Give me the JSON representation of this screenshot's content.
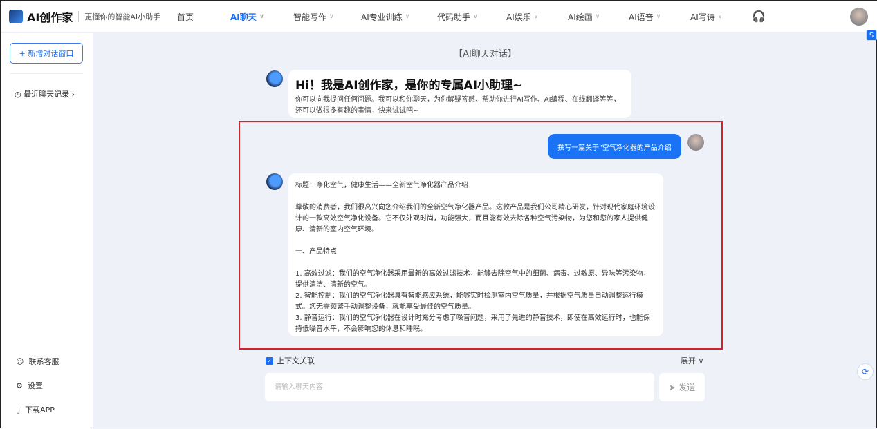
{
  "header": {
    "logo": "AI创作家",
    "slogan": "更懂你的智能AI小助手",
    "nav": [
      {
        "label": "首页",
        "chev": false
      },
      {
        "label": "AI聊天",
        "chev": true,
        "active": true
      },
      {
        "label": "智能写作",
        "chev": true
      },
      {
        "label": "AI专业训练",
        "chev": true
      },
      {
        "label": "代码助手",
        "chev": true
      },
      {
        "label": "AI娱乐",
        "chev": true
      },
      {
        "label": "AI绘画",
        "chev": true
      },
      {
        "label": "AI语音",
        "chev": true
      },
      {
        "label": "AI写诗",
        "chev": true
      }
    ]
  },
  "sidebar": {
    "new_chat": "+ 新增对话窗口",
    "history": "最近聊天记录 ›",
    "contact": "联系客服",
    "settings": "设置",
    "download": "下载APP"
  },
  "chat": {
    "title": "【AI聊天对话】",
    "welcome_title": "Hi！我是AI创作家，是你的专属AI小助理~",
    "welcome_desc": "你可以向我提问任何问题。我可以和你聊天，为你解疑答惑、帮助你进行AI写作、AI编程、在线翻译等等，还可以做很多有趣的事情，快来试试吧~",
    "user_message": "撰写一篇关于\"空气净化器的产品介绍",
    "response": [
      "标题：净化空气，健康生活——全新空气净化器产品介绍",
      "",
      "尊敬的消费者，我们很高兴向您介绍我们的全新空气净化器产品。这款产品是我们公司精心研发，针对现代家庭环境设计的一款高效空气净化设备。它不仅外观时尚，功能强大，而且能有效去除各种空气污染物，为您和您的家人提供健康、清新的室内空气环境。",
      "",
      "一、产品特点",
      "",
      "1. 高效过滤：我们的空气净化器采用最新的高效过滤技术，能够去除空气中的细菌、病毒、过敏原、异味等污染物，提供清洁、清新的空气。",
      "2. 智能控制：我们的空气净化器具有智能感应系统，能够实时检测室内空气质量，并根据空气质量自动调整运行模式。您无需频繁手动调整设备，就能享受最佳的空气质量。",
      "3. 静音运行：我们的空气净化器在设计时充分考虑了噪音问题，采用了先进的静音技术，即使在高效运行时，也能保持低噪音水平，不会影响您的休息和睡眠。"
    ]
  },
  "footer": {
    "context_label": "上下文关联",
    "expand": "展开 ∨",
    "placeholder": "请输入聊天内容",
    "send": "发送"
  }
}
